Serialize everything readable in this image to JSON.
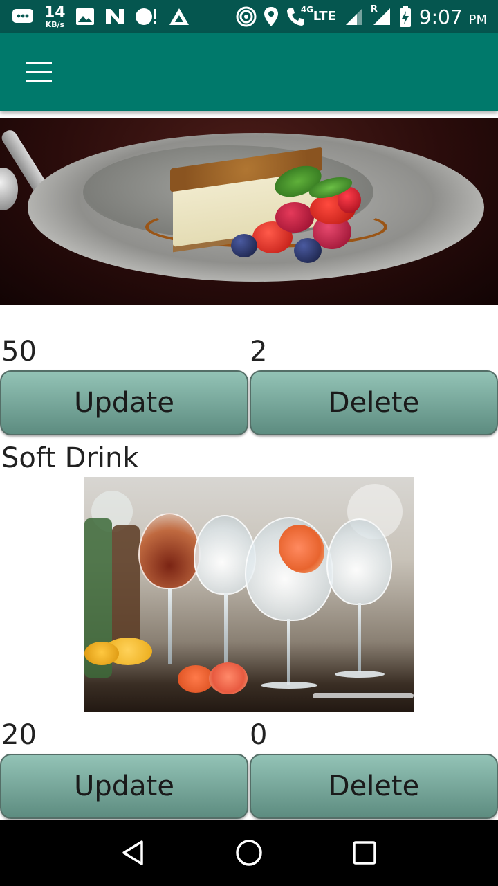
{
  "status_bar": {
    "speed_value": "14",
    "speed_unit": "KB/s",
    "network_label": "LTE",
    "network_sub": "4G",
    "roaming": "R",
    "time": "9:07",
    "ampm": "PM"
  },
  "items": [
    {
      "title": "",
      "image": "cheesecake-dessert-photo",
      "price": "50",
      "quantity": "2",
      "update_label": "Update",
      "delete_label": "Delete"
    },
    {
      "title": "Soft Drink",
      "image": "cocktail-glasses-photo",
      "price": "20",
      "quantity": "0",
      "update_label": "Update",
      "delete_label": "Delete"
    }
  ],
  "colors": {
    "status_bar": "#05564f",
    "app_bar": "#00796b",
    "button_top": "#93c3b6",
    "button_bottom": "#5d8c80"
  }
}
